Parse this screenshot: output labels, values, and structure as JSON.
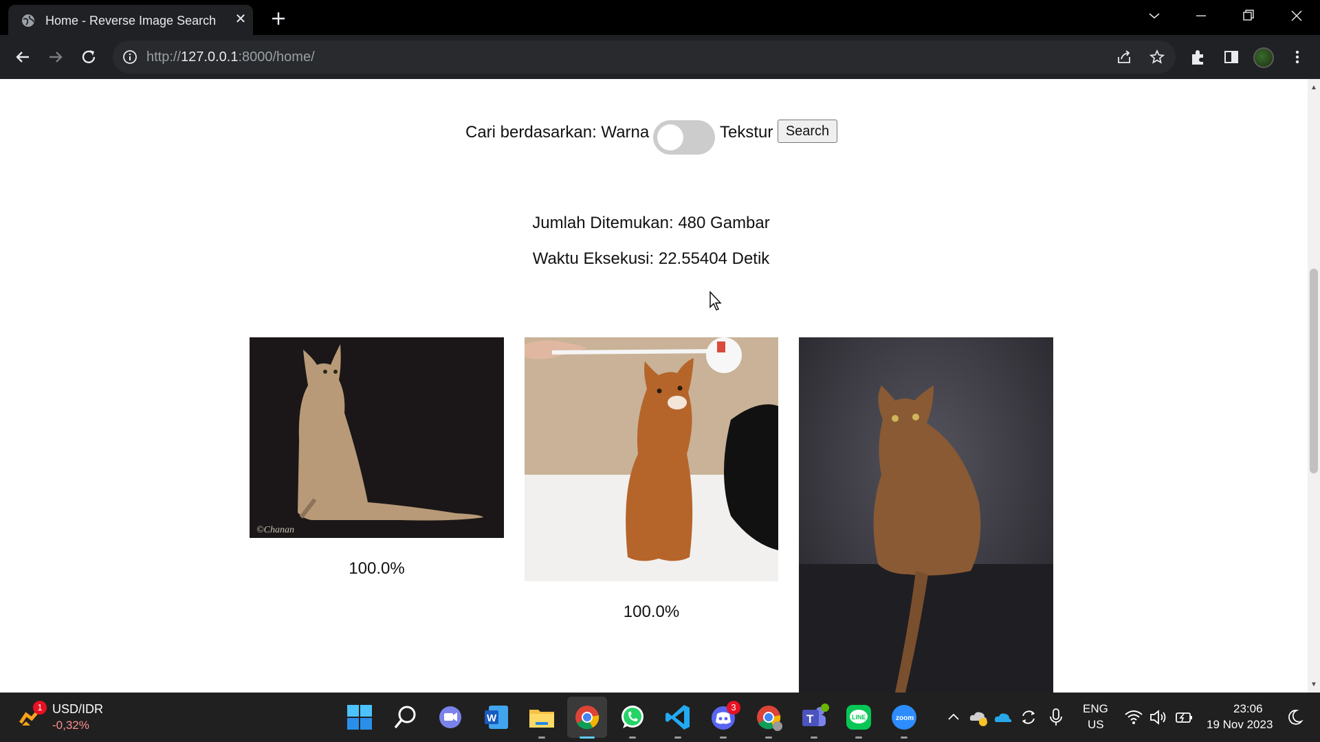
{
  "browser": {
    "tab_title": "Home - Reverse Image Search",
    "url_scheme": "http://",
    "url_host": "127.0.0.1",
    "url_rest": ":8000/home/"
  },
  "page": {
    "search_label_prefix": "Cari berdasarkan: Warna",
    "search_label_suffix": "Tekstur",
    "toggle_checked": false,
    "search_button": "Search",
    "found_count_text": "Jumlah Ditemukan: 480 Gambar",
    "exec_time_text": "Waktu Eksekusi: 22.55404 Detik",
    "results": [
      {
        "image": "abyssinian-cat-sitting-dark-bg-icon",
        "similarity": "100.0%"
      },
      {
        "image": "ginger-cat-playing-with-toy-icon",
        "similarity": "100.0%"
      },
      {
        "image": "abyssinian-cat-looking-back-icon",
        "similarity": ""
      }
    ],
    "result_watermark": "©Chanan"
  },
  "taskbar": {
    "widget_title": "USD/IDR",
    "widget_value": "-0,32%",
    "widget_badge": "1",
    "discord_badge": "3",
    "lang_line1": "ENG",
    "lang_line2": "US",
    "time": "23:06",
    "date": "19 Nov 2023",
    "apps": [
      "windows-start",
      "search",
      "teams-chat",
      "word",
      "file-explorer",
      "chrome",
      "whatsapp",
      "vscode",
      "discord",
      "chrome-profile",
      "teams",
      "line",
      "zoom"
    ]
  },
  "colors": {
    "chrome_dark": "#202124",
    "taskbar": "#202020",
    "toggle_off": "#cccccc",
    "active_indicator": "#60cdff"
  }
}
